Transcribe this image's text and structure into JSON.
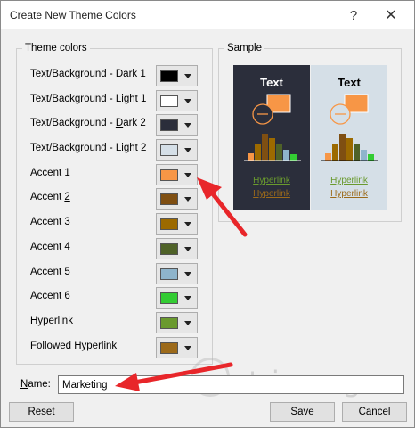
{
  "window": {
    "title": "Create New Theme Colors",
    "help_glyph": "?",
    "close_glyph": "✕"
  },
  "theme_colors": {
    "legend": "Theme colors",
    "rows": [
      {
        "pre": "",
        "acc": "T",
        "post": "ext/Background - Dark 1",
        "color": "#000000"
      },
      {
        "pre": "Te",
        "acc": "x",
        "post": "t/Background - Light 1",
        "color": "#ffffff"
      },
      {
        "pre": "Text/Background - ",
        "acc": "D",
        "post": "ark 2",
        "color": "#2b2e3b"
      },
      {
        "pre": "Text/Background - Light ",
        "acc": "2",
        "post": "",
        "color": "#d5dfe7"
      },
      {
        "pre": "Accent ",
        "acc": "1",
        "post": "",
        "color": "#f79646"
      },
      {
        "pre": "Accent ",
        "acc": "2",
        "post": "",
        "color": "#7f4f12"
      },
      {
        "pre": "Accent ",
        "acc": "3",
        "post": "",
        "color": "#9c6a00"
      },
      {
        "pre": "Accent ",
        "acc": "4",
        "post": "",
        "color": "#4f6228"
      },
      {
        "pre": "Accent ",
        "acc": "5",
        "post": "",
        "color": "#8eb4cb"
      },
      {
        "pre": "Accent ",
        "acc": "6",
        "post": "",
        "color": "#33cc33"
      },
      {
        "pre": "",
        "acc": "H",
        "post": "yperlink",
        "color": "#6a9a2e"
      },
      {
        "pre": "",
        "acc": "F",
        "post": "ollowed Hyperlink",
        "color": "#9c6a1a"
      }
    ]
  },
  "sample": {
    "legend": "Sample",
    "text_label": "Text",
    "hyperlink": "Hyperlink",
    "followed_hyperlink": "Hyperlink"
  },
  "name": {
    "label_acc": "N",
    "label_post": "ame:",
    "value": "Marketing"
  },
  "buttons": {
    "reset": {
      "pre": "",
      "acc": "R",
      "post": "eset"
    },
    "save": {
      "pre": "",
      "acc": "S",
      "post": "ave"
    },
    "cancel": {
      "pre": "Cancel",
      "acc": "",
      "post": ""
    }
  },
  "watermark": "uantrimang",
  "colors": {
    "annotation_arrow": "#e8262a",
    "dark_text": "#ffffff",
    "light_text": "#000000"
  }
}
